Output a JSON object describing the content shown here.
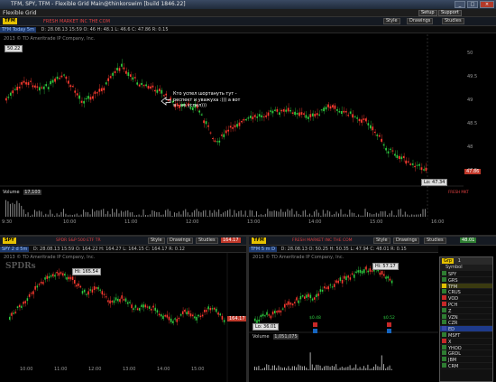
{
  "window": {
    "title": "TFM, SPY, TFM - Flexible Grid  Main@thinkorswim [build 1846.22]",
    "buttons": [
      "_",
      "□",
      "×"
    ]
  },
  "menubar": {
    "layout_name": "Flexible Grid",
    "setup": "Setup",
    "support": "Support"
  },
  "top_chart": {
    "symbol": "TFM",
    "title": "FRESH MARKET INC THE COM",
    "today_label": "TFM Today 5m",
    "quote": "D: 28.08.13 15:59   O: 46   H: 48.1   L: 46.6   C: 47.86   R: 0.15",
    "copyright": "2013 © TD Ameritrade IP Company, Inc.",
    "style_btn": "Style",
    "drawings_btn": "Drawings",
    "studies_btn": "Studies",
    "high_label": "50.22",
    "current_price": "47.86",
    "low_label": "Lo: 47.34",
    "annotation": "Кто успел шортануть тут - респект и уважуха :))) а вот я - не успел)))",
    "volume_label": "Volume",
    "volume_value": "17,103",
    "volume_cap": "FRESH MKT",
    "y_ticks": [
      "50",
      "49.5",
      "49",
      "48.5",
      "48",
      "47.5"
    ],
    "x_ticks": [
      "9:30",
      "10:00",
      "11:00",
      "12:00",
      "13:00",
      "14:00",
      "15:00",
      "16:00"
    ]
  },
  "bottom_left_chart": {
    "symbol": "SPY",
    "title": "SPDR S&P 500 ETF TR",
    "today_label": "SPY 2 d 5m",
    "quote": "D: 28.08.13 15:59   O: 164.22   H: 164.27   L: 164.15   C: 164.17   R: 0.12",
    "copyright": "2013 © TD Ameritrade IP Company, Inc.",
    "brand": "SPDRs",
    "style_btn": "Style",
    "drawings_btn": "Drawings",
    "studies_btn": "Studies",
    "last_price": "164.17",
    "high_label": "Hi: 165.54",
    "x_ticks": [
      "10:00",
      "11:00",
      "12:00",
      "13:00",
      "14:00",
      "15:00"
    ]
  },
  "bottom_right_chart": {
    "symbol": "TFM",
    "title": "FRESH MARKET INC THE COM",
    "today_label": "TFM 5 m D",
    "quote": "D: 28.08.13   O: 50.25   H: 50.35   L: 47.94   C: 48.01   R: 0.15",
    "copyright": "2013 © TD Ameritrade IP Company, Inc.",
    "style_btn": "Style",
    "drawings_btn": "Drawings",
    "studies_btn": "Studies",
    "last_price": "48.01",
    "high_label": "Hi: 57.17",
    "low_label": "Lo: 36.01",
    "marker1": "$0.48",
    "marker2": "$0.52",
    "volume_label": "Volume",
    "volume_value": "1,051,075"
  },
  "watchlist": {
    "header_left": "Grp",
    "header_right": "1",
    "column": "Symbol",
    "items": [
      {
        "sym": "SPY",
        "color": "#2e7d32"
      },
      {
        "sym": "GRS",
        "color": "#2e7d32"
      },
      {
        "sym": "TFM",
        "color": "#e0c000"
      },
      {
        "sym": "CRUS",
        "color": "#2e7d32"
      },
      {
        "sym": "VOD",
        "color": "#c62828"
      },
      {
        "sym": "PCH",
        "color": "#c62828"
      },
      {
        "sym": "Z",
        "color": "#2e7d32"
      },
      {
        "sym": "VZN",
        "color": "#2e7d32"
      },
      {
        "sym": "CZR",
        "color": "#2e7d32"
      },
      {
        "sym": "ED",
        "color": "#3949ab"
      },
      {
        "sym": "MSFT",
        "color": "#2e7d32"
      },
      {
        "sym": "X",
        "color": "#c62828"
      },
      {
        "sym": "YHOO",
        "color": "#2e7d32"
      },
      {
        "sym": "GRDL",
        "color": "#2e7d32"
      },
      {
        "sym": "JBM",
        "color": "#2e7d32"
      },
      {
        "sym": "CRM",
        "color": "#2e7d32"
      }
    ]
  },
  "colors": {
    "up": "#2ecc40",
    "down": "#ff3b30",
    "symbol_box": "#e6c200",
    "price_tag_red": "#c0392b",
    "price_tag_green": "#2e7d32"
  }
}
